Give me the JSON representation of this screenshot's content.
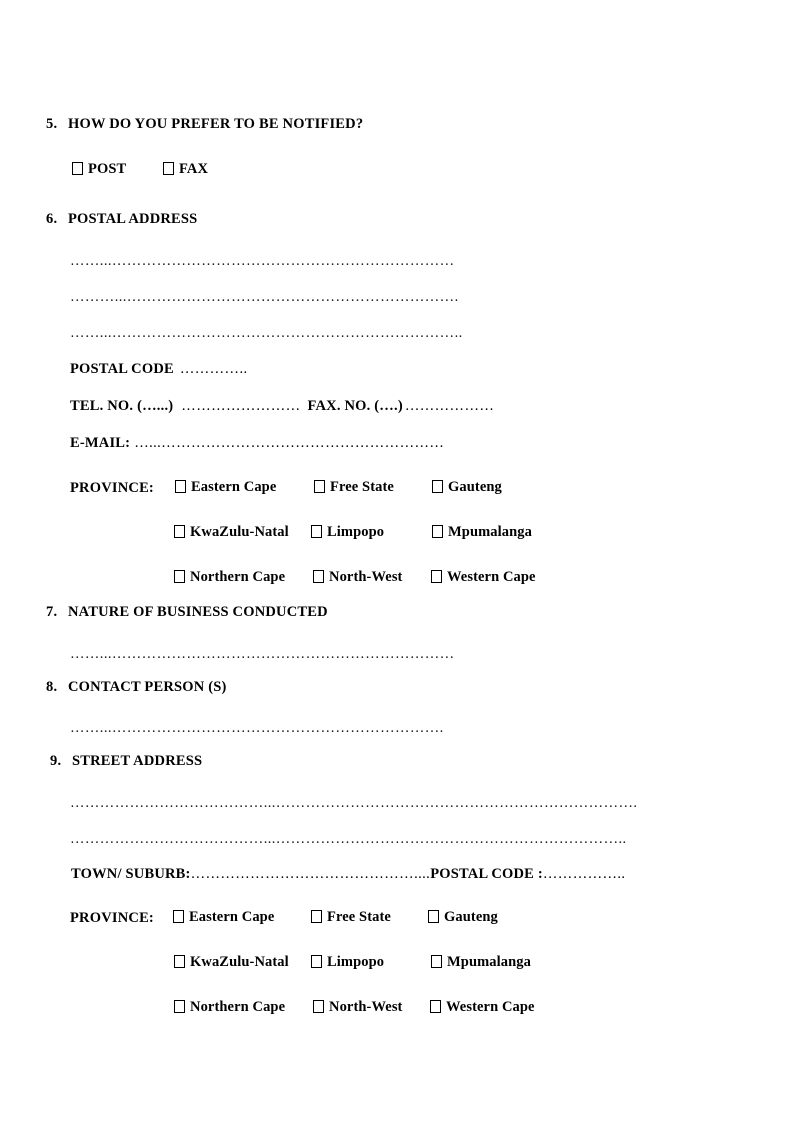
{
  "document": {
    "type": "registration-form-page",
    "page_background": "#ffffff",
    "text_color": "#000000"
  },
  "sections": {
    "q5": {
      "number": "5.",
      "title": "HOW DO YOU PREFER TO BE NOTIFIED?",
      "options": [
        {
          "label": "POST"
        },
        {
          "label": "FAX"
        }
      ]
    },
    "q6": {
      "number": "6.",
      "title": "POSTAL ADDRESS",
      "address_lines": [
        "……...……………………………………………………………",
        "………...………………………………………………………….",
        "……...……………………………………………………………..",
        "……...……………………………………………………………."
      ],
      "postal_code_label": "POSTAL CODE",
      "postal_code_dots": "…………..",
      "tel_label": "TEL. NO. (…...)",
      "tel_dots": "……………………",
      "fax_label": "FAX. NO. (….)",
      "fax_dots": "………………",
      "email_label": "E-MAIL:",
      "email_dots": "…...…………………………………………………",
      "province_label": "PROVINCE:",
      "provinces": [
        "Eastern Cape",
        "Free State",
        "Gauteng",
        "KwaZulu-Natal",
        "Limpopo",
        "Mpumalanga",
        "Northern Cape",
        "North-West",
        "Western Cape"
      ]
    },
    "q7": {
      "number": "7.",
      "title": "NATURE OF BUSINESS CONDUCTED",
      "dots": "……...……………………………………………………………"
    },
    "q8": {
      "number": "8.",
      "title": "CONTACT PERSON (S)",
      "dots": "……...…………………………………………………………."
    },
    "q9": {
      "number": "9.",
      "title": "STREET ADDRESS",
      "address_lines": [
        "…………………………………...……………………………………………………………….",
        "…………………………………...…………………………………………………………….."
      ],
      "town_label": "TOWN/ SUBURB:",
      "town_dots": "………………………………………....",
      "street_postal_code_label": "POSTAL CODE :",
      "street_postal_code_dots": "……………..",
      "province_label": "PROVINCE:",
      "provinces": [
        "Eastern Cape",
        "Free State",
        "Gauteng",
        "KwaZulu-Natal",
        "Limpopo",
        "Mpumalanga",
        "Northern Cape",
        "North-West",
        "Western Cape"
      ]
    }
  }
}
